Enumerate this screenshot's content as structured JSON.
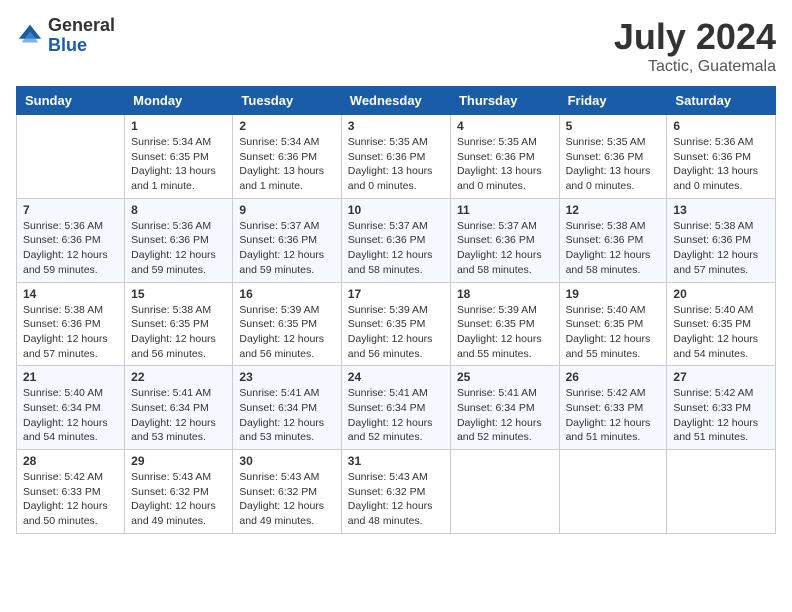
{
  "header": {
    "logo": {
      "general": "General",
      "blue": "Blue"
    },
    "month": "July 2024",
    "location": "Tactic, Guatemala"
  },
  "weekdays": [
    "Sunday",
    "Monday",
    "Tuesday",
    "Wednesday",
    "Thursday",
    "Friday",
    "Saturday"
  ],
  "weeks": [
    [
      {
        "day": null
      },
      {
        "day": 1,
        "sunrise": "5:34 AM",
        "sunset": "6:35 PM",
        "daylight": "13 hours and 1 minute."
      },
      {
        "day": 2,
        "sunrise": "5:34 AM",
        "sunset": "6:36 PM",
        "daylight": "13 hours and 1 minute."
      },
      {
        "day": 3,
        "sunrise": "5:35 AM",
        "sunset": "6:36 PM",
        "daylight": "13 hours and 0 minutes."
      },
      {
        "day": 4,
        "sunrise": "5:35 AM",
        "sunset": "6:36 PM",
        "daylight": "13 hours and 0 minutes."
      },
      {
        "day": 5,
        "sunrise": "5:35 AM",
        "sunset": "6:36 PM",
        "daylight": "13 hours and 0 minutes."
      },
      {
        "day": 6,
        "sunrise": "5:36 AM",
        "sunset": "6:36 PM",
        "daylight": "13 hours and 0 minutes."
      }
    ],
    [
      {
        "day": 7,
        "sunrise": "5:36 AM",
        "sunset": "6:36 PM",
        "daylight": "12 hours and 59 minutes."
      },
      {
        "day": 8,
        "sunrise": "5:36 AM",
        "sunset": "6:36 PM",
        "daylight": "12 hours and 59 minutes."
      },
      {
        "day": 9,
        "sunrise": "5:37 AM",
        "sunset": "6:36 PM",
        "daylight": "12 hours and 59 minutes."
      },
      {
        "day": 10,
        "sunrise": "5:37 AM",
        "sunset": "6:36 PM",
        "daylight": "12 hours and 58 minutes."
      },
      {
        "day": 11,
        "sunrise": "5:37 AM",
        "sunset": "6:36 PM",
        "daylight": "12 hours and 58 minutes."
      },
      {
        "day": 12,
        "sunrise": "5:38 AM",
        "sunset": "6:36 PM",
        "daylight": "12 hours and 58 minutes."
      },
      {
        "day": 13,
        "sunrise": "5:38 AM",
        "sunset": "6:36 PM",
        "daylight": "12 hours and 57 minutes."
      }
    ],
    [
      {
        "day": 14,
        "sunrise": "5:38 AM",
        "sunset": "6:36 PM",
        "daylight": "12 hours and 57 minutes."
      },
      {
        "day": 15,
        "sunrise": "5:38 AM",
        "sunset": "6:35 PM",
        "daylight": "12 hours and 56 minutes."
      },
      {
        "day": 16,
        "sunrise": "5:39 AM",
        "sunset": "6:35 PM",
        "daylight": "12 hours and 56 minutes."
      },
      {
        "day": 17,
        "sunrise": "5:39 AM",
        "sunset": "6:35 PM",
        "daylight": "12 hours and 56 minutes."
      },
      {
        "day": 18,
        "sunrise": "5:39 AM",
        "sunset": "6:35 PM",
        "daylight": "12 hours and 55 minutes."
      },
      {
        "day": 19,
        "sunrise": "5:40 AM",
        "sunset": "6:35 PM",
        "daylight": "12 hours and 55 minutes."
      },
      {
        "day": 20,
        "sunrise": "5:40 AM",
        "sunset": "6:35 PM",
        "daylight": "12 hours and 54 minutes."
      }
    ],
    [
      {
        "day": 21,
        "sunrise": "5:40 AM",
        "sunset": "6:34 PM",
        "daylight": "12 hours and 54 minutes."
      },
      {
        "day": 22,
        "sunrise": "5:41 AM",
        "sunset": "6:34 PM",
        "daylight": "12 hours and 53 minutes."
      },
      {
        "day": 23,
        "sunrise": "5:41 AM",
        "sunset": "6:34 PM",
        "daylight": "12 hours and 53 minutes."
      },
      {
        "day": 24,
        "sunrise": "5:41 AM",
        "sunset": "6:34 PM",
        "daylight": "12 hours and 52 minutes."
      },
      {
        "day": 25,
        "sunrise": "5:41 AM",
        "sunset": "6:34 PM",
        "daylight": "12 hours and 52 minutes."
      },
      {
        "day": 26,
        "sunrise": "5:42 AM",
        "sunset": "6:33 PM",
        "daylight": "12 hours and 51 minutes."
      },
      {
        "day": 27,
        "sunrise": "5:42 AM",
        "sunset": "6:33 PM",
        "daylight": "12 hours and 51 minutes."
      }
    ],
    [
      {
        "day": 28,
        "sunrise": "5:42 AM",
        "sunset": "6:33 PM",
        "daylight": "12 hours and 50 minutes."
      },
      {
        "day": 29,
        "sunrise": "5:43 AM",
        "sunset": "6:32 PM",
        "daylight": "12 hours and 49 minutes."
      },
      {
        "day": 30,
        "sunrise": "5:43 AM",
        "sunset": "6:32 PM",
        "daylight": "12 hours and 49 minutes."
      },
      {
        "day": 31,
        "sunrise": "5:43 AM",
        "sunset": "6:32 PM",
        "daylight": "12 hours and 48 minutes."
      },
      {
        "day": null
      },
      {
        "day": null
      },
      {
        "day": null
      }
    ]
  ],
  "labels": {
    "sunrise": "Sunrise:",
    "sunset": "Sunset:",
    "daylight": "Daylight:"
  }
}
